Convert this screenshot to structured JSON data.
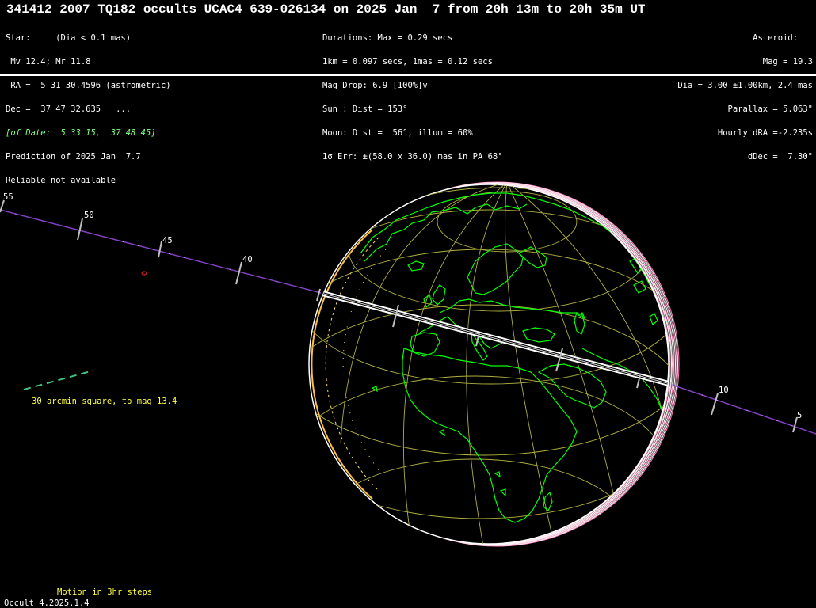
{
  "title": "341412 2007 TQ182 occults UCAC4 639-026134 on 2025 Jan  7 from 20h 13m to 20h 35m UT",
  "star_block": [
    "Star:     (Dia < 0.1 mas)",
    " Mv 12.4; Mr 11.8",
    " RA =  5 31 30.4596 (astrometric)",
    "Dec =  37 47 32.635   ...",
    "[of Date:  5 33 15,  37 48 45]",
    "Prediction of 2025 Jan  7.7",
    "Reliable not available"
  ],
  "mid_block": [
    "Durations: Max = 0.29 secs",
    "1km = 0.097 secs, 1mas = 0.12 secs",
    "Mag Drop: 6.9 [100%]v",
    "Sun : Dist = 153°",
    "Moon: Dist =  56°, illum = 60%",
    "1σ Err: ±(58.0 x 36.0) mas in PA 68°"
  ],
  "asteroid_block": [
    "Asteroid:   ",
    "Mag = 19.3",
    "Dia = 3.00 ±1.00km, 2.4 mas",
    "Parallax = 5.063\"",
    "Hourly dRA =-2.235s",
    "dDec =  7.30\""
  ],
  "time_ticks": [
    "55",
    "50",
    "45",
    "40",
    "10",
    "5"
  ],
  "scale_label": "30 arcmin square, to mag 13.4",
  "motion_label": "Motion in 3hr steps",
  "version_label": "Occult 4.2025.1.4",
  "colors": {
    "coastline": "#00ff00",
    "graticule": "#b0b040",
    "shadow_path": "#ffffff",
    "motion_line": "#8040c0",
    "limit_orange": "#ffc040",
    "header_text": "#ffffff",
    "label_yellow": "#ffff40"
  }
}
